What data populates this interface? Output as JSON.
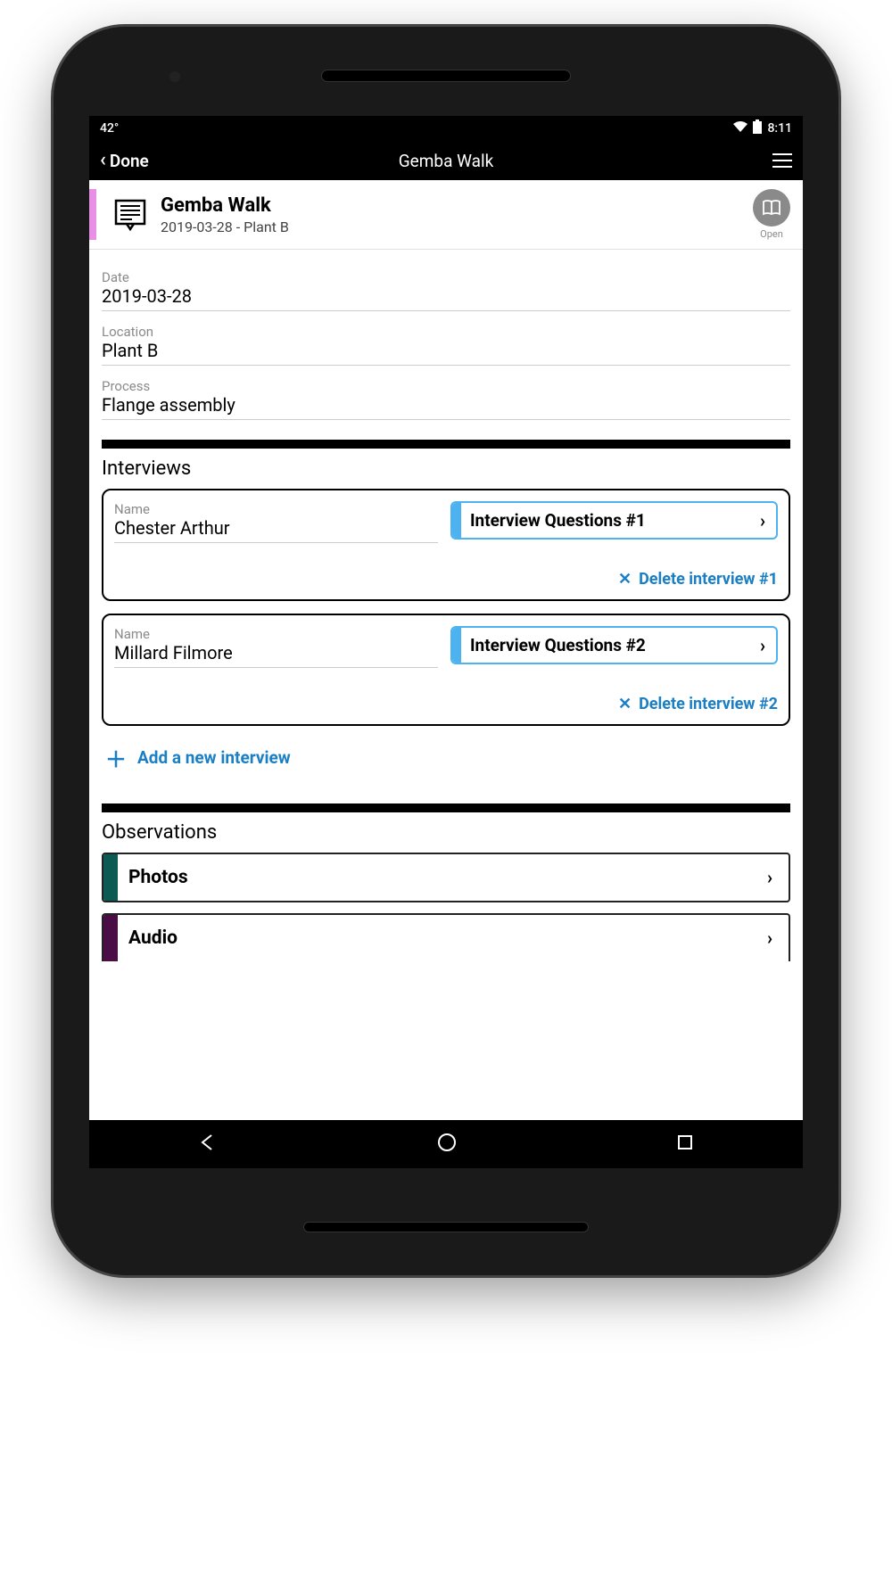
{
  "status": {
    "temp": "42°",
    "time": "8:11"
  },
  "nav": {
    "back": "Done",
    "title": "Gemba Walk"
  },
  "card": {
    "title": "Gemba Walk",
    "subtitle": "2019-03-28 - Plant B",
    "open": "Open"
  },
  "fields": {
    "date_label": "Date",
    "date_value": "2019-03-28",
    "location_label": "Location",
    "location_value": "Plant B",
    "process_label": "Process",
    "process_value": "Flange assembly"
  },
  "interviews": {
    "title": "Interviews",
    "name_label": "Name",
    "items": [
      {
        "name": "Chester Arthur",
        "iq": "Interview Questions #1",
        "delete": "Delete interview #1"
      },
      {
        "name": "Millard Filmore",
        "iq": "Interview Questions #2",
        "delete": "Delete interview #2"
      }
    ],
    "add": "Add a new interview"
  },
  "observations": {
    "title": "Observations",
    "items": [
      {
        "label": "Photos",
        "accent": "#0d5a54"
      },
      {
        "label": "Audio",
        "accent": "#4a0d45"
      }
    ]
  }
}
